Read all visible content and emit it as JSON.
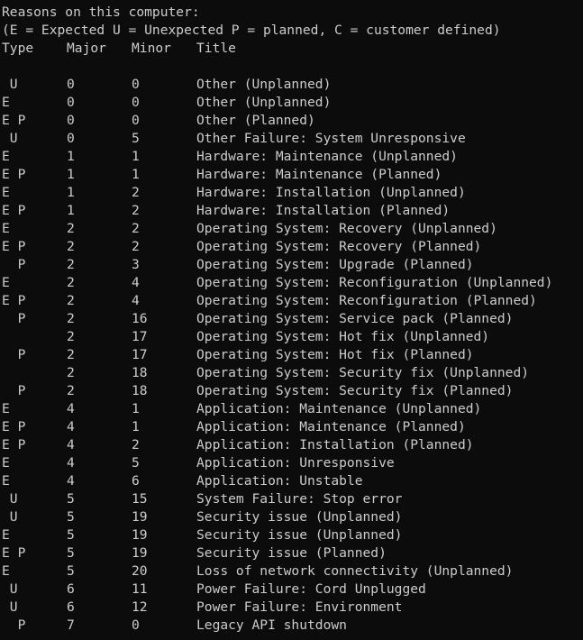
{
  "colors": {
    "background": "#0c0c0c",
    "text": "#cccccc"
  },
  "intro": {
    "heading": "Reasons on this computer:",
    "legend": "(E = Expected U = Unexpected P = planned, C = customer defined)"
  },
  "columns": {
    "type": "Type",
    "major": "Major",
    "minor": "Minor",
    "title": "Title"
  },
  "rows": [
    {
      "type": " U",
      "major": "0",
      "minor": "0",
      "title": "Other (Unplanned)"
    },
    {
      "type": "E",
      "major": "0",
      "minor": "0",
      "title": "Other (Unplanned)"
    },
    {
      "type": "E P",
      "major": "0",
      "minor": "0",
      "title": "Other (Planned)"
    },
    {
      "type": " U",
      "major": "0",
      "minor": "5",
      "title": "Other Failure: System Unresponsive"
    },
    {
      "type": "E",
      "major": "1",
      "minor": "1",
      "title": "Hardware: Maintenance (Unplanned)"
    },
    {
      "type": "E P",
      "major": "1",
      "minor": "1",
      "title": "Hardware: Maintenance (Planned)"
    },
    {
      "type": "E",
      "major": "1",
      "minor": "2",
      "title": "Hardware: Installation (Unplanned)"
    },
    {
      "type": "E P",
      "major": "1",
      "minor": "2",
      "title": "Hardware: Installation (Planned)"
    },
    {
      "type": "E",
      "major": "2",
      "minor": "2",
      "title": "Operating System: Recovery (Unplanned)"
    },
    {
      "type": "E P",
      "major": "2",
      "minor": "2",
      "title": "Operating System: Recovery (Planned)"
    },
    {
      "type": "  P",
      "major": "2",
      "minor": "3",
      "title": "Operating System: Upgrade (Planned)"
    },
    {
      "type": "E",
      "major": "2",
      "minor": "4",
      "title": "Operating System: Reconfiguration (Unplanned)"
    },
    {
      "type": "E P",
      "major": "2",
      "minor": "4",
      "title": "Operating System: Reconfiguration (Planned)"
    },
    {
      "type": "  P",
      "major": "2",
      "minor": "16",
      "title": "Operating System: Service pack (Planned)"
    },
    {
      "type": "",
      "major": "2",
      "minor": "17",
      "title": "Operating System: Hot fix (Unplanned)"
    },
    {
      "type": "  P",
      "major": "2",
      "minor": "17",
      "title": "Operating System: Hot fix (Planned)"
    },
    {
      "type": "",
      "major": "2",
      "minor": "18",
      "title": "Operating System: Security fix (Unplanned)"
    },
    {
      "type": "  P",
      "major": "2",
      "minor": "18",
      "title": "Operating System: Security fix (Planned)"
    },
    {
      "type": "E",
      "major": "4",
      "minor": "1",
      "title": "Application: Maintenance (Unplanned)"
    },
    {
      "type": "E P",
      "major": "4",
      "minor": "1",
      "title": "Application: Maintenance (Planned)"
    },
    {
      "type": "E P",
      "major": "4",
      "minor": "2",
      "title": "Application: Installation (Planned)"
    },
    {
      "type": "E",
      "major": "4",
      "minor": "5",
      "title": "Application: Unresponsive"
    },
    {
      "type": "E",
      "major": "4",
      "minor": "6",
      "title": "Application: Unstable"
    },
    {
      "type": " U",
      "major": "5",
      "minor": "15",
      "title": "System Failure: Stop error"
    },
    {
      "type": " U",
      "major": "5",
      "minor": "19",
      "title": "Security issue (Unplanned)"
    },
    {
      "type": "E",
      "major": "5",
      "minor": "19",
      "title": "Security issue (Unplanned)"
    },
    {
      "type": "E P",
      "major": "5",
      "minor": "19",
      "title": "Security issue (Planned)"
    },
    {
      "type": "E",
      "major": "5",
      "minor": "20",
      "title": "Loss of network connectivity (Unplanned)"
    },
    {
      "type": " U",
      "major": "6",
      "minor": "11",
      "title": "Power Failure: Cord Unplugged"
    },
    {
      "type": " U",
      "major": "6",
      "minor": "12",
      "title": "Power Failure: Environment"
    },
    {
      "type": "  P",
      "major": "7",
      "minor": "0",
      "title": "Legacy API shutdown"
    }
  ]
}
